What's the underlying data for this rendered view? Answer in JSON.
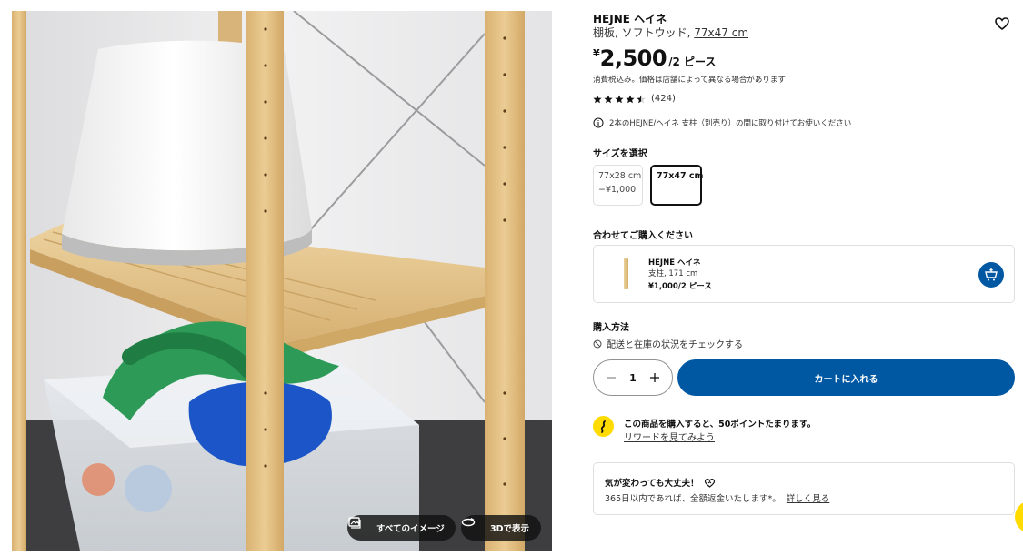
{
  "product": {
    "title": "HEJNE ヘイネ",
    "subtitle_text": "棚板, ソフトウッド, ",
    "subtitle_size_link": "77x47 cm",
    "price_currency": "¥",
    "price_amount": "2,500",
    "price_unit": "/2 ピース",
    "tax_note": "消費税込み。価格は店舗によって異なる場合があります",
    "rating_value": 4.5,
    "rating_count": "(424)",
    "info_note": "2本のHEJNE/ヘイネ 支柱（別売り）の間に取り付けてお使いください",
    "wishlist_icon": "heart-icon"
  },
  "size_selector": {
    "label": "サイズを選択",
    "options": [
      {
        "label": "77x28 cm",
        "sub": "−¥1,000",
        "selected": false
      },
      {
        "label": "77x47 cm",
        "sub": "",
        "selected": true
      }
    ]
  },
  "combo": {
    "label": "合わせてご購入ください",
    "item_name": "HEJNE ヘイネ",
    "item_desc": "支柱, 171 cm",
    "item_price": "¥1,000/2 ピース",
    "add_icon": "add-to-cart-icon"
  },
  "purchase": {
    "label": "購入方法",
    "stock_link": "配送と在庫の状況をチェックする",
    "quantity": "1",
    "add_to_cart": "カートに入れる"
  },
  "rewards": {
    "text": "この商品を購入すると、50ポイントたまります。",
    "link": "リワードを見てみよう"
  },
  "returns": {
    "title": "気が変わっても大丈夫！",
    "text": "365日以内であれば、全額返金いたします*。",
    "link": "詳しく見る"
  },
  "photo": {
    "all_images_label": "すべてのイメージ",
    "view_3d_label": "3Dで表示"
  },
  "colors": {
    "accent": "#0058a3",
    "reward_yellow": "#ffdb00"
  }
}
